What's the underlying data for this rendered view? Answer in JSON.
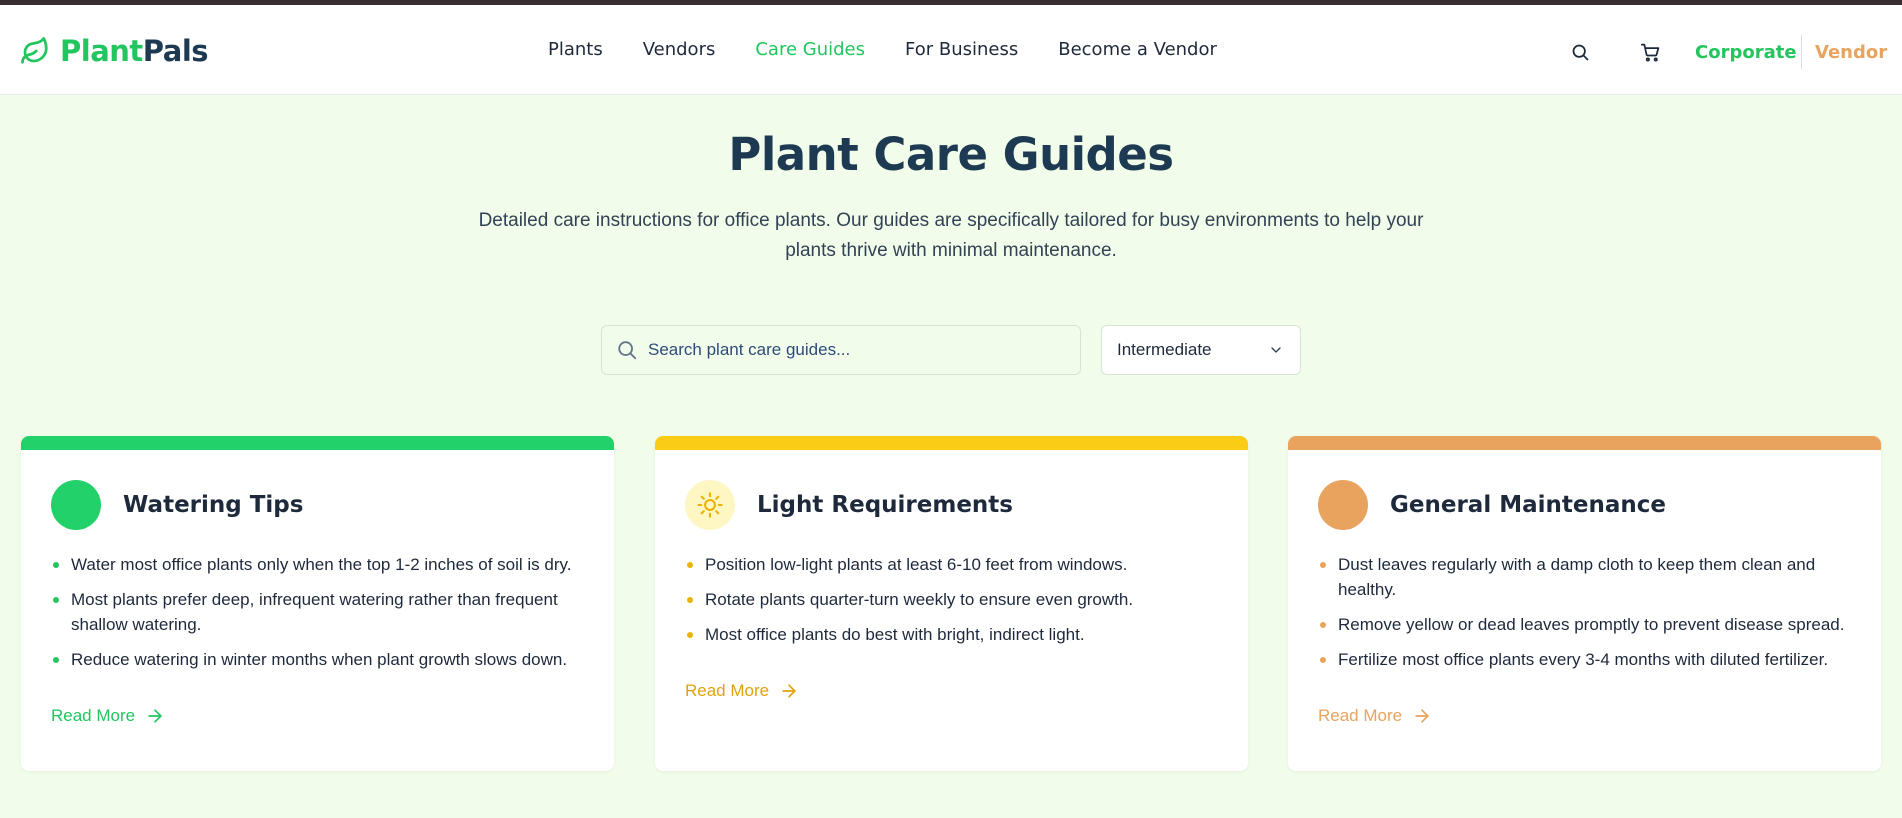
{
  "brand": {
    "name_part1": "Plant",
    "name_part2": "Pals"
  },
  "nav": [
    {
      "label": "Plants",
      "active": false
    },
    {
      "label": "Vendors",
      "active": false
    },
    {
      "label": "Care Guides",
      "active": true
    },
    {
      "label": "For Business",
      "active": false
    },
    {
      "label": "Become a Vendor",
      "active": false
    }
  ],
  "header": {
    "corporate_label": "Corporate",
    "vendor_label": "Vendor"
  },
  "page": {
    "title": "Plant Care Guides",
    "description": "Detailed care instructions for office plants. Our guides are specifically tailored for busy environments to help your plants thrive with minimal maintenance."
  },
  "search": {
    "placeholder": "Search plant care guides..."
  },
  "filter": {
    "selected": "Intermediate"
  },
  "colors": {
    "green": "#22c55e",
    "yellow": "#facc15",
    "orange": "#e8a35e",
    "navy": "#1e3a52",
    "page_bg": "#f1fdea"
  },
  "cards": [
    {
      "title": "Watering Tips",
      "icon": "solid-circle-icon",
      "tips": [
        "Water most office plants only when the top 1-2 inches of soil is dry.",
        "Most plants prefer deep, infrequent watering rather than frequent shallow watering.",
        "Reduce watering in winter months when plant growth slows down."
      ],
      "read_more": "Read More"
    },
    {
      "title": "Light Requirements",
      "icon": "sun-icon",
      "tips": [
        "Position low-light plants at least 6-10 feet from windows.",
        "Rotate plants quarter-turn weekly to ensure even growth.",
        "Most office plants do best with bright, indirect light."
      ],
      "read_more": "Read More"
    },
    {
      "title": "General Maintenance",
      "icon": "solid-circle-icon",
      "tips": [
        "Dust leaves regularly with a damp cloth to keep them clean and healthy.",
        "Remove yellow or dead leaves promptly to prevent disease spread.",
        "Fertilize most office plants every 3-4 months with diluted fertilizer."
      ],
      "read_more": "Read More"
    }
  ]
}
